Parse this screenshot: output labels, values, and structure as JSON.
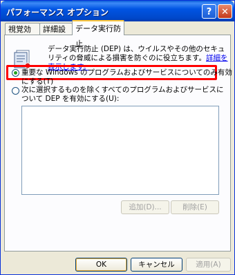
{
  "window": {
    "title": "パフォーマンス オプション",
    "help_label": "?",
    "close_label": "✕"
  },
  "tabs": [
    {
      "label": "視覚効果"
    },
    {
      "label": "詳細設定"
    },
    {
      "label": "データ実行防止"
    }
  ],
  "description": {
    "text": "データ実行防止 (DEP) は、ウイルスやその他のセキュリティの脅威による損害を防ぐのに役立ちます。",
    "link": "詳細を表示します。"
  },
  "options": [
    {
      "label": "重要な Windows のプログラムおよびサービスについてのみ有効にする(T)",
      "selected": true
    },
    {
      "label": "次に選択するものを除くすべてのプログラムおよびサービスについて DEP を有効にする(U):",
      "selected": false
    }
  ],
  "buttons": {
    "add": "追加(D)...",
    "remove": "削除(E)",
    "ok": "OK",
    "cancel": "キャンセル",
    "apply": "適用(A)"
  },
  "colors": {
    "titlebar": "#0054e3",
    "highlight": "#ff0000",
    "window_bg": "#ece9d8"
  }
}
